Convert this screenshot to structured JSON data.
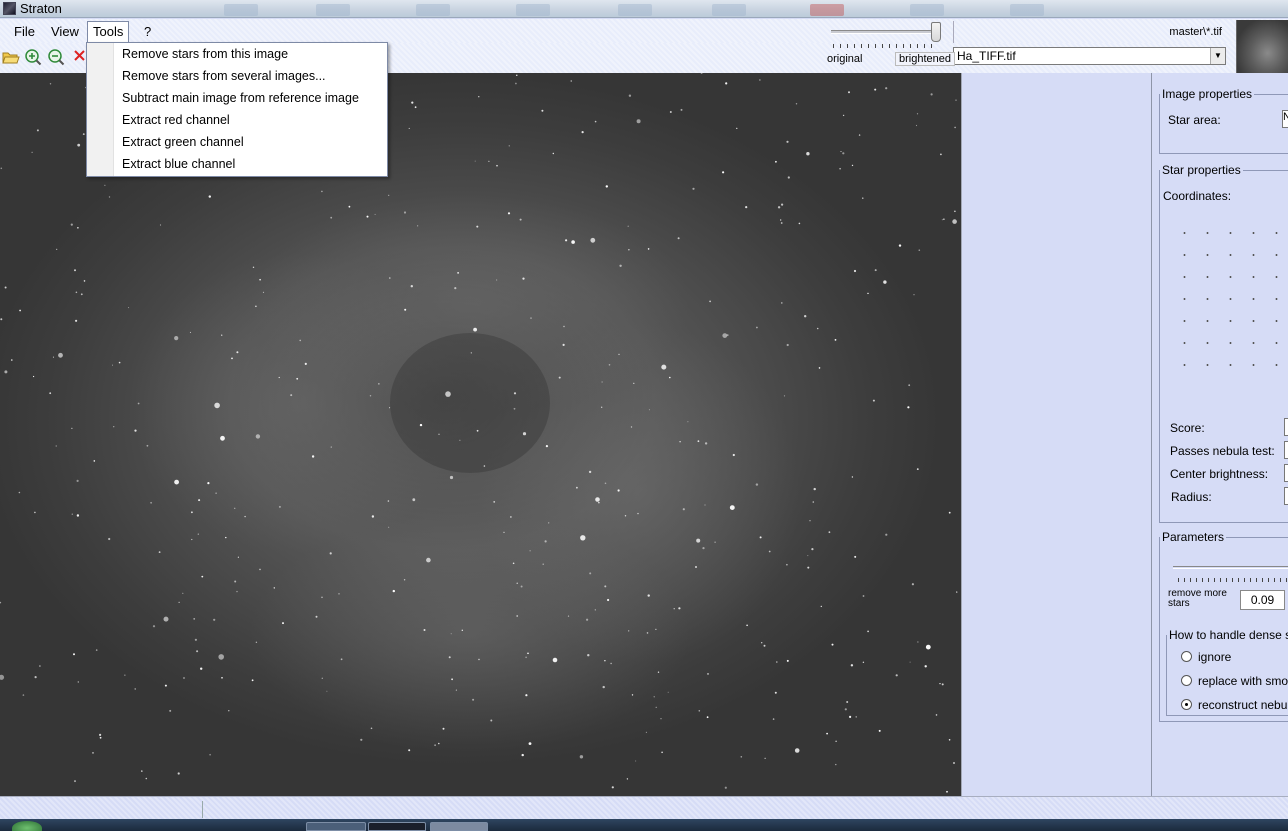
{
  "window": {
    "title": "Straton"
  },
  "menubar": {
    "items": [
      "File",
      "View",
      "Tools",
      "?"
    ],
    "active": "Tools"
  },
  "tools_menu": {
    "items": [
      "Remove stars from this image",
      "Remove stars from several images...",
      "Subtract main image from reference image",
      "Extract red channel",
      "Extract green channel",
      "Extract blue channel"
    ]
  },
  "toolbar": {
    "icons": [
      "open-folder-icon",
      "zoom-in-icon",
      "zoom-out-icon",
      "close-image-icon"
    ],
    "view_slider": {
      "left_label": "original",
      "right_label": "brightened",
      "position": 1.0
    },
    "file_mask": "master\\*.tif",
    "file_select": {
      "value": "Ha_TIFF.tif"
    }
  },
  "panel": {
    "image_properties": {
      "legend": "Image properties",
      "star_area_label": "Star area:",
      "star_area_value": "N"
    },
    "star_properties": {
      "legend": "Star properties",
      "coordinates_label": "Coordinates:",
      "score_label": "Score:",
      "nebula_label": "Passes nebula test:",
      "brightness_label": "Center brightness:",
      "radius_label": "Radius:"
    },
    "parameters": {
      "legend": "Parameters",
      "remove_more_label": "remove more stars",
      "threshold_value": "0.09",
      "dense_legend": "How to handle dense st",
      "options": [
        "ignore",
        "replace with smoot",
        "reconstruct nebula"
      ],
      "selected_option": 2
    }
  }
}
